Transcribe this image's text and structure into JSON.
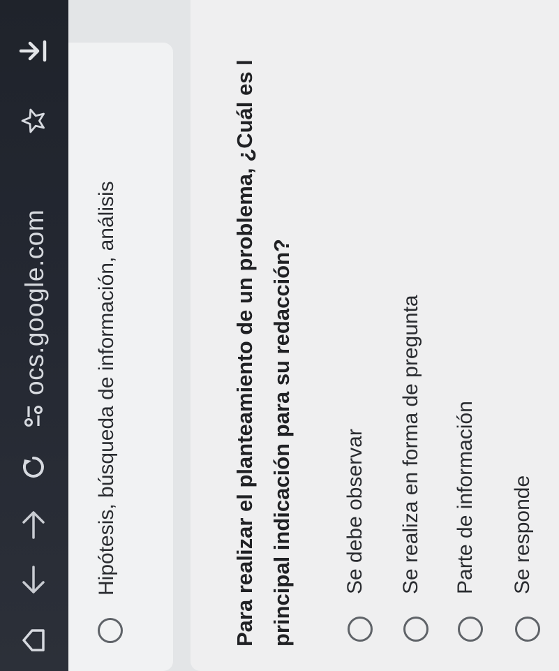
{
  "browser": {
    "url": "ocs.google.com",
    "icons": [
      "home-icon",
      "back-arrow-icon",
      "forward-arrow-icon",
      "reload-icon",
      "site-settings-icon",
      "bookmark-star-icon",
      "download-icon"
    ]
  },
  "previous_question": {
    "option_label": "Hipótesis, búsqueda de información, análisis"
  },
  "question": {
    "text_line1": "Para realizar el planteamiento de un problema, ¿Cuál es l",
    "text_line2": "principal indicación para su redacción?",
    "options": [
      {
        "label": "Se debe observar",
        "selected": false
      },
      {
        "label": "Se realiza en forma de pregunta",
        "selected": false
      },
      {
        "label": "Parte de información",
        "selected": false
      },
      {
        "label": "Se responde",
        "selected": false
      }
    ]
  }
}
